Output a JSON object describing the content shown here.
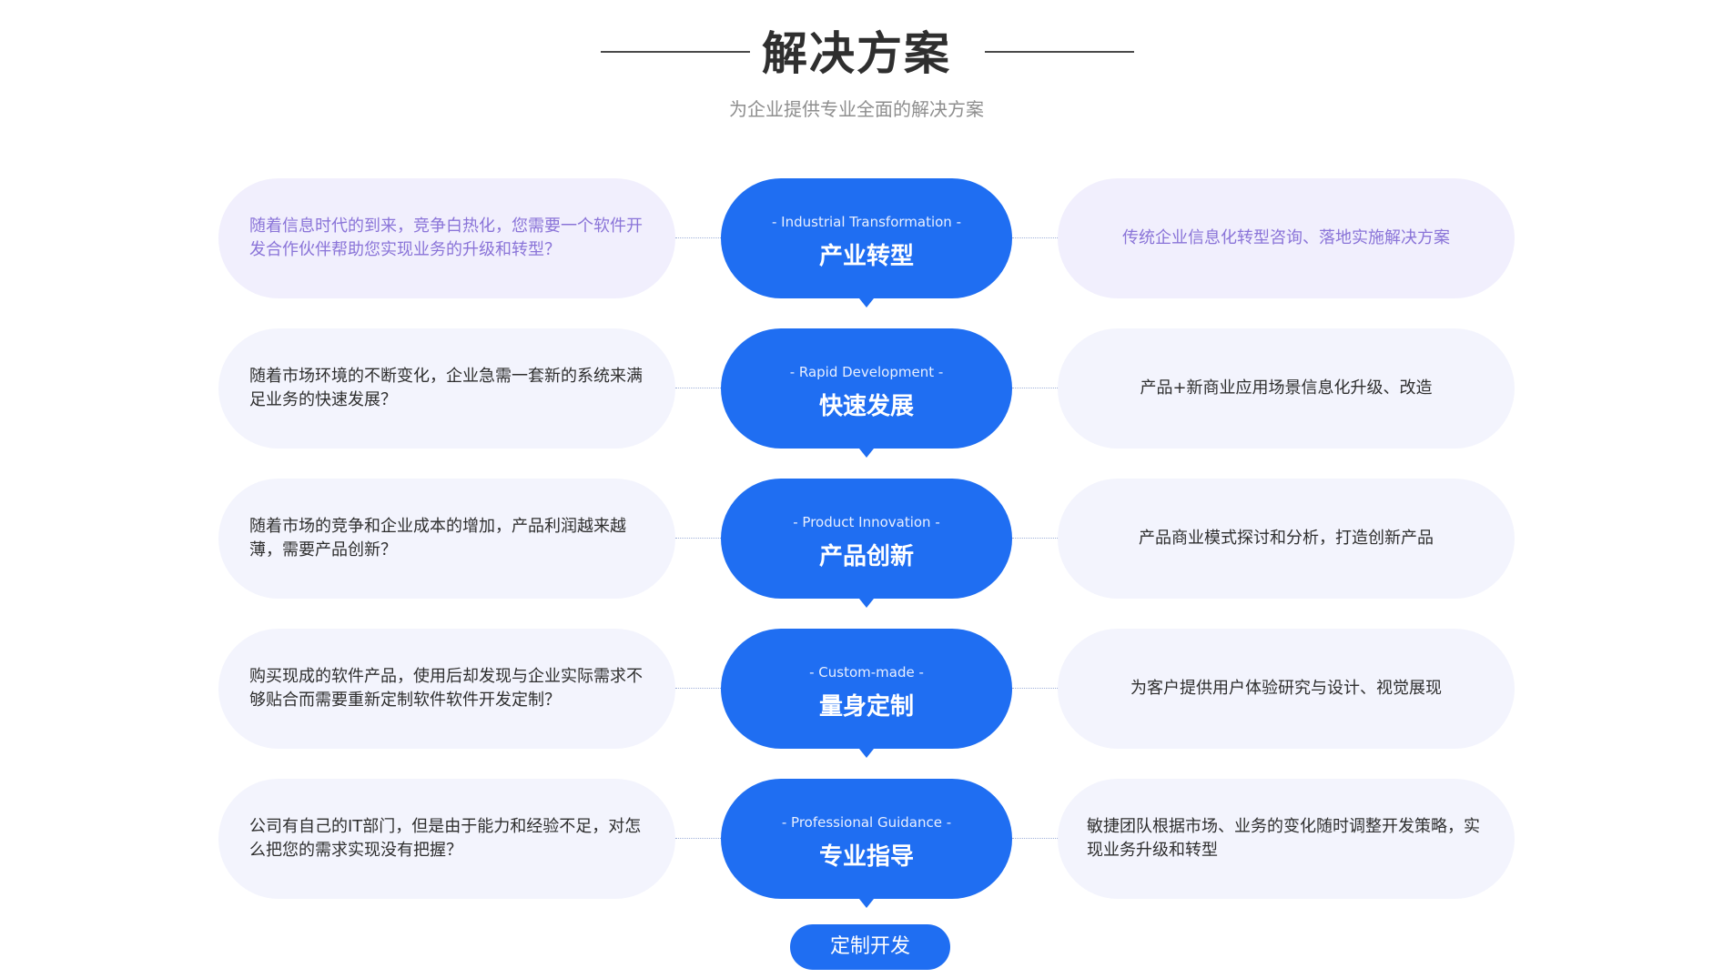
{
  "header": {
    "title": "解决方案",
    "subtitle": "为企业提供专业全面的解决方案"
  },
  "rows": [
    {
      "left_text": "随着信息时代的到来，竞争白热化，您需要一个软件开发合作伙伴帮助您实现业务的升级和转型？",
      "center_en": "- Industrial Transformation -",
      "center_cn": "产业转型",
      "right_text": "传统企业信息化转型咨询、落地实施解决方案"
    },
    {
      "left_text": "随着市场环境的不断变化，企业急需一套新的系统来满足业务的快速发展？",
      "center_en": "- Rapid Development -",
      "center_cn": "快速发展",
      "right_text": "产品+新商业应用场景信息化升级、改造"
    },
    {
      "left_text": "随着市场的竞争和企业成本的增加，产品利润越来越薄，需要产品创新？",
      "center_en": "- Product Innovation -",
      "center_cn": "产品创新",
      "right_text": "产品商业模式探讨和分析，打造创新产品"
    },
    {
      "left_text": "购买现成的软件产品，使用后却发现与企业实际需求不够贴合而需要重新定制软件软件开发定制？",
      "center_en": "- Custom-made -",
      "center_cn": "量身定制",
      "right_text": "为客户提供用户体验研究与设计、视觉展现"
    },
    {
      "left_text": "公司有自己的IT部门，但是由于能力和经验不足，对怎么把您的需求实现没有把握？",
      "center_en": "- Professional Guidance -",
      "center_cn": "专业指导",
      "right_text": "敏捷团队根据市场、业务的变化随时调整开发策略，实现业务升级和转型"
    }
  ],
  "cta": {
    "label": "定制开发"
  },
  "colors": {
    "primary_blue": "#1f6ef2",
    "bubble_bg": "#f3f4fd",
    "accent_text": "#8a74d8"
  }
}
